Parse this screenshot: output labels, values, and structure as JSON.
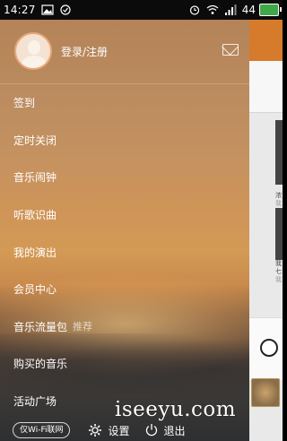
{
  "statusbar": {
    "time": "14:27",
    "battery_level": "44",
    "icons": [
      "image-icon",
      "check-circle-icon",
      "alarm-icon",
      "wifi-icon",
      "signal-icon",
      "battery-icon"
    ]
  },
  "drawer": {
    "profile": {
      "login_label": "登录/注册"
    },
    "menu": [
      {
        "label": "签到"
      },
      {
        "label": "定时关闭"
      },
      {
        "label": "音乐闹钟"
      },
      {
        "label": "听歌识曲"
      },
      {
        "label": "我的演出"
      },
      {
        "label": "会员中心"
      },
      {
        "label": "音乐流量包",
        "badge": "推荐"
      },
      {
        "label": "购买的音乐"
      },
      {
        "label": "活动广场"
      }
    ],
    "footer": {
      "wifi_label": "仅Wi-Fi联网",
      "settings_label": "设置",
      "exit_label": "退出"
    }
  },
  "background_app": {
    "card1_text": [
      "浓",
      "我"
    ],
    "card2_text": [
      "我",
      "七",
      "我"
    ]
  },
  "watermark": "iseeyu.com",
  "colors": {
    "statusbar_bg": "#0b0b0b",
    "app_accent": "#d67a2c",
    "battery_fill": "#40a848"
  }
}
